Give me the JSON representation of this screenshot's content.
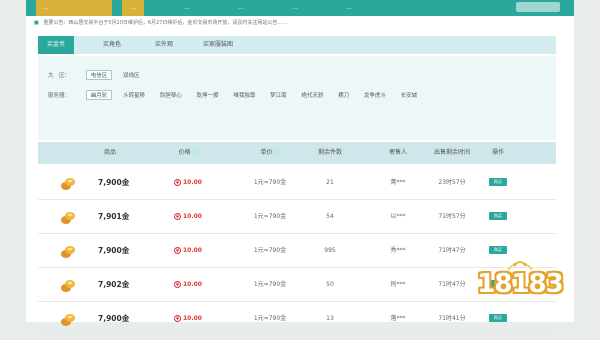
{
  "nav": {
    "brand": "…",
    "items": [
      "…",
      "…",
      "…",
      "…",
      "…"
    ]
  },
  "notice": {
    "text": "重要公告：西山居交易平台于5月20日维护后，6月27日维护后，金币交易市场开放，请及时关注网站公告……"
  },
  "tabs": [
    {
      "label": "买金币",
      "active": true
    },
    {
      "label": "买角色",
      "active": false
    },
    {
      "label": "买外观",
      "active": false
    },
    {
      "label": "买家服装图",
      "active": false
    }
  ],
  "filters": {
    "region_label": "大　区：",
    "regions": [
      {
        "label": "电信区",
        "active": true
      },
      {
        "label": "双线区",
        "active": false
      }
    ],
    "server_label": "服务器：",
    "servers": [
      {
        "label": "幽月轮",
        "active": true
      },
      {
        "label": "斗转星移",
        "active": false
      },
      {
        "label": "剑胆琴心",
        "active": false
      },
      {
        "label": "乾坤一掷",
        "active": false
      },
      {
        "label": "唯我独尊",
        "active": false
      },
      {
        "label": "梦江南",
        "active": false
      },
      {
        "label": "绝代天骄",
        "active": false
      },
      {
        "label": "横刀",
        "active": false
      },
      {
        "label": "龙争虎斗",
        "active": false
      },
      {
        "label": "长安城",
        "active": false
      }
    ]
  },
  "table": {
    "headers": {
      "item": "商品",
      "price": "价格",
      "unit": "单价",
      "remaining": "剩余件数",
      "seller": "寄售人",
      "time_left": "出售剩余时间",
      "action": "操作"
    },
    "rows": [
      {
        "amount": "7,900金",
        "price": "10.00",
        "unit": "1元=790金",
        "remaining": "21",
        "seller": "菁***",
        "time_left": "23时57分",
        "buy": "购买"
      },
      {
        "amount": "7,901金",
        "price": "10.00",
        "unit": "1元=790金",
        "remaining": "54",
        "seller": "以***",
        "time_left": "71时57分",
        "buy": "购买"
      },
      {
        "amount": "7,900金",
        "price": "10.00",
        "unit": "1元=790金",
        "remaining": "995",
        "seller": "秀***",
        "time_left": "71时47分",
        "buy": "购买"
      },
      {
        "amount": "7,902金",
        "price": "10.00",
        "unit": "1元=790金",
        "remaining": "50",
        "seller": "刑***",
        "time_left": "71时47分",
        "buy": "购买"
      },
      {
        "amount": "7,900金",
        "price": "10.00",
        "unit": "1元=790金",
        "remaining": "13",
        "seller": "落***",
        "time_left": "71时41分",
        "buy": "购买"
      }
    ],
    "currency_symbol": "¥"
  },
  "watermark": {
    "text": "18183"
  },
  "colors": {
    "accent": "#2aa89c",
    "brand_gold": "#d9b23a",
    "price_red": "#d33333"
  },
  "icons": {
    "gold": "gold-ingot-icon",
    "sort": "sort-icon"
  }
}
